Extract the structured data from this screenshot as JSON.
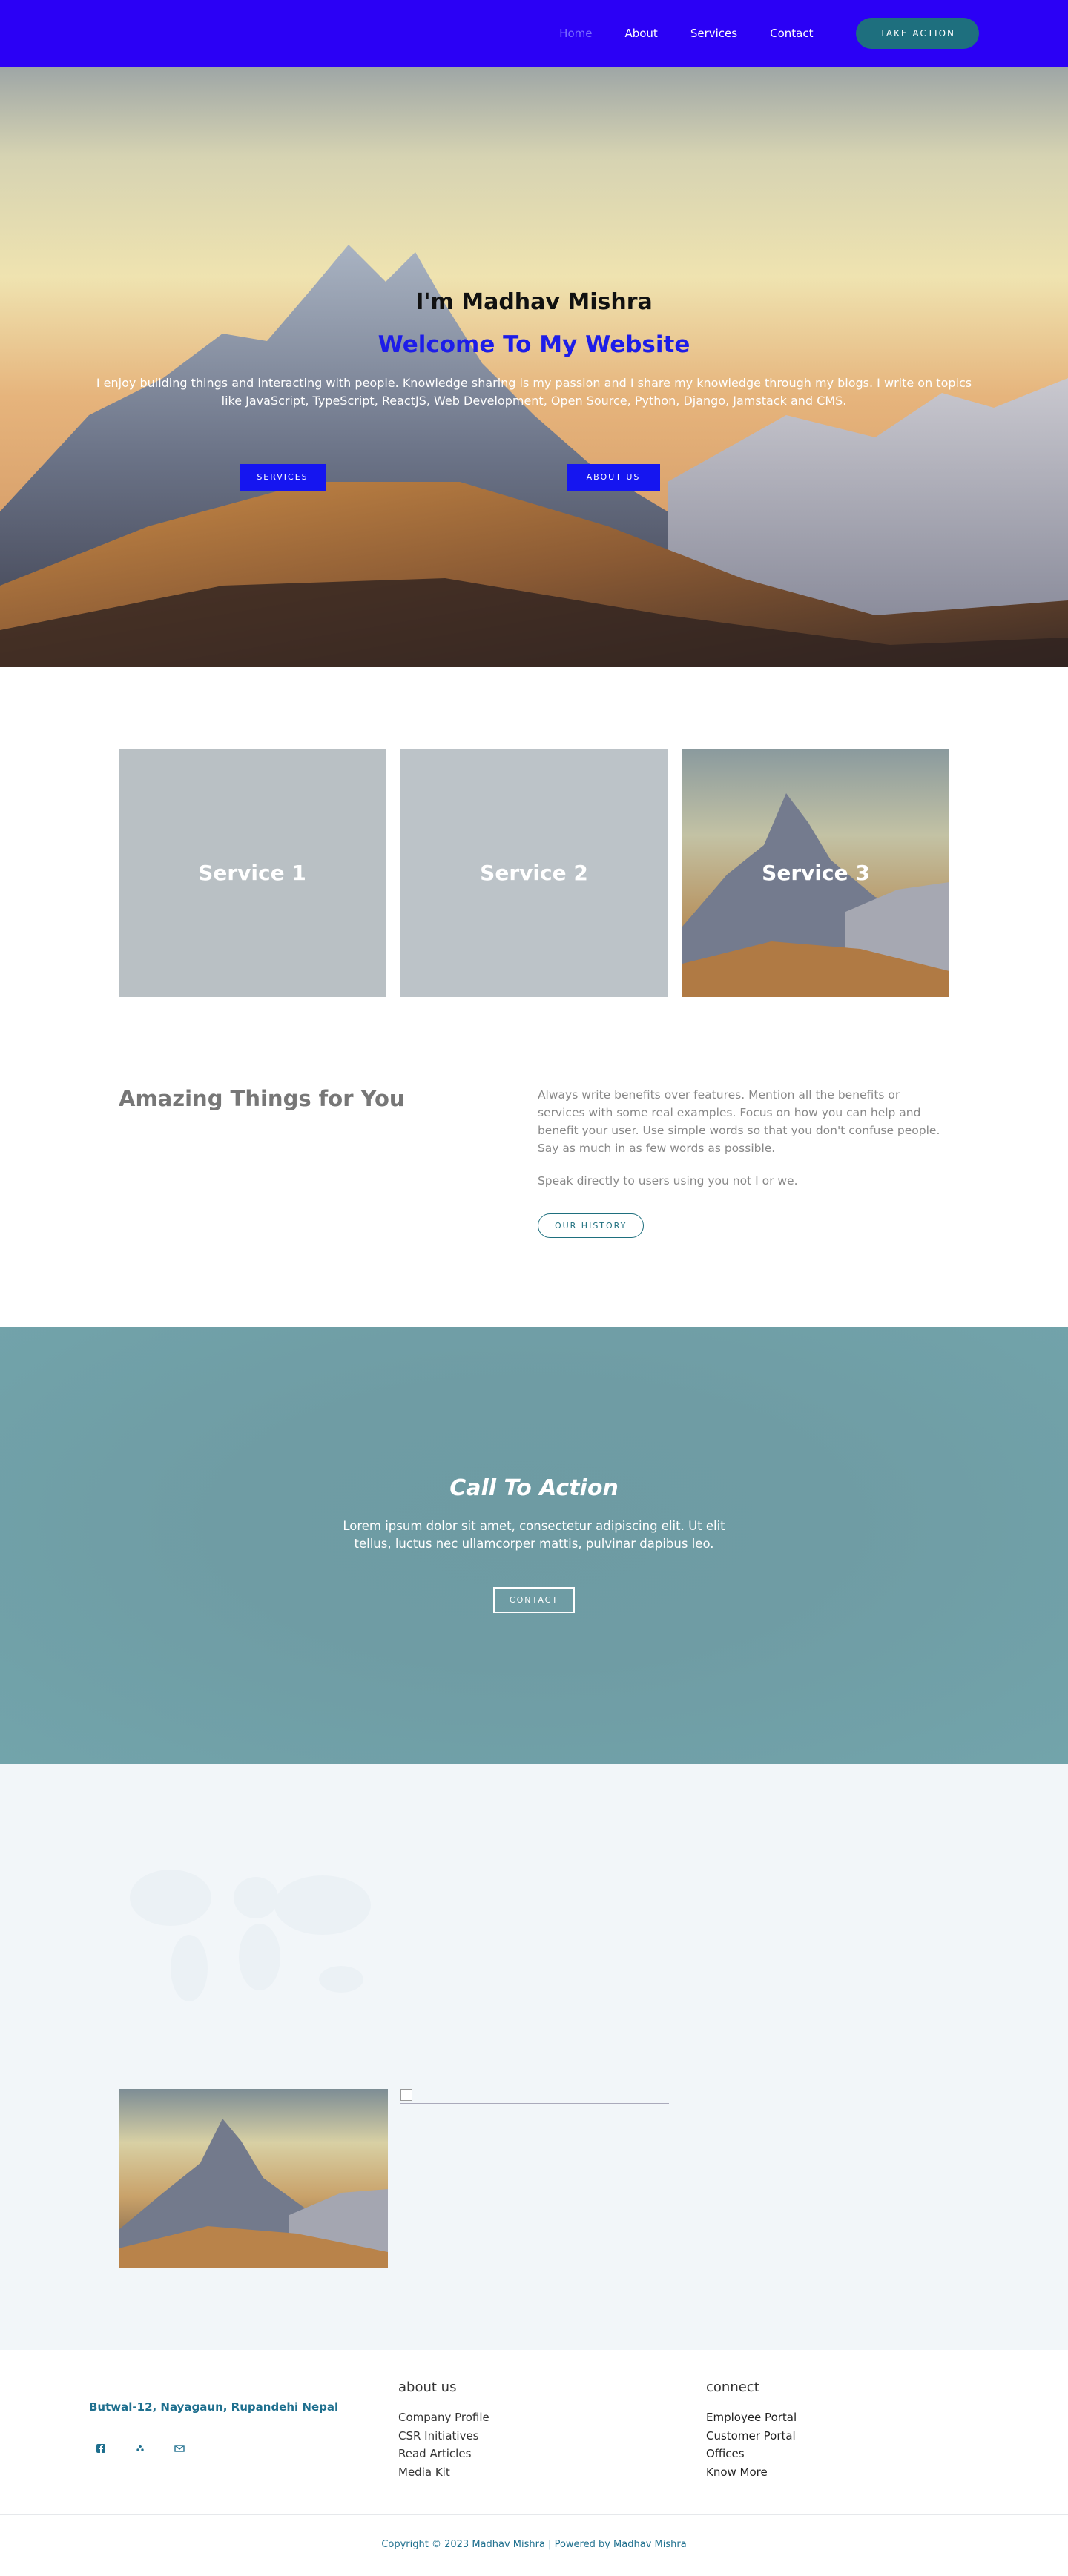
{
  "header": {
    "nav": [
      "Home",
      "About",
      "Services",
      "Contact"
    ],
    "cta_label": "TAKE ACTION"
  },
  "hero": {
    "name": "I'm Madhav Mishra",
    "welcome": "Welcome To My Website",
    "description": "I enjoy building things and interacting with people. Knowledge sharing is my passion and I share my knowledge through my blogs. I write on topics like JavaScript, TypeScript, ReactJS, Web Development, Open Source, Python, Django, Jamstack and CMS.",
    "services_btn": "SERVICES",
    "about_btn": "ABOUT US"
  },
  "services": [
    {
      "label": "Service 1"
    },
    {
      "label": "Service 2"
    },
    {
      "label": "Service 3"
    }
  ],
  "amazing": {
    "title": "Amazing Things for You",
    "paragraph1": "Always write benefits over features. Mention all the benefits or services with some real examples. Focus on how you can help and benefit your user. Use simple words so that you don't confuse people. Say as much in as few words as possible.",
    "paragraph2": "Speak directly to users using you not I or we.",
    "button": "OUR HISTORY"
  },
  "cta": {
    "title": "Call To Action",
    "text": "Lorem ipsum dolor sit amet, consectetur adipiscing elit. Ut elit tellus, luctus nec ullamcorper mattis, pulvinar dapibus leo.",
    "button": "CONTACT"
  },
  "footer": {
    "address": "Butwal-12, Nayagaun, Rupandehi Nepal",
    "socials": [
      "facebook-icon",
      "yelp-icon",
      "mail-icon"
    ],
    "about_title": "about us",
    "about_links": [
      "Company Profile",
      "CSR Initiatives",
      "Read Articles",
      "Media Kit"
    ],
    "connect_title": "connect",
    "connect_links": [
      "Employee Portal",
      "Customer Portal",
      "Offices",
      "Know More"
    ],
    "copyright": "Copyright © 2023 Madhav Mishra | Powered by Madhav Mishra"
  },
  "colors": {
    "header_bg": "#2b00f5",
    "accent_teal": "#1e6f7e",
    "hero_button": "#1515f0",
    "welcome_text": "#1d1de8",
    "cta_bg": "#6f9ca4",
    "gallery_bg": "#f2f6f9"
  }
}
